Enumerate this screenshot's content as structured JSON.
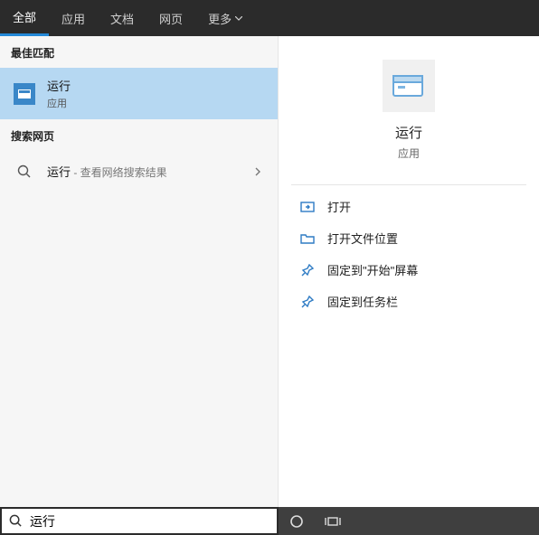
{
  "tabs": {
    "all": "全部",
    "apps": "应用",
    "documents": "文档",
    "web": "网页",
    "more": "更多"
  },
  "left": {
    "best_match_header": "最佳匹配",
    "best_match": {
      "title": "运行",
      "subtitle": "应用"
    },
    "web_header": "搜索网页",
    "web_result": {
      "title": "运行",
      "suffix": " - 查看网络搜索结果"
    }
  },
  "right": {
    "title": "运行",
    "subtitle": "应用",
    "actions": {
      "open": "打开",
      "open_location": "打开文件位置",
      "pin_start": "固定到\"开始\"屏幕",
      "pin_taskbar": "固定到任务栏"
    }
  },
  "search": {
    "value": "运行"
  }
}
